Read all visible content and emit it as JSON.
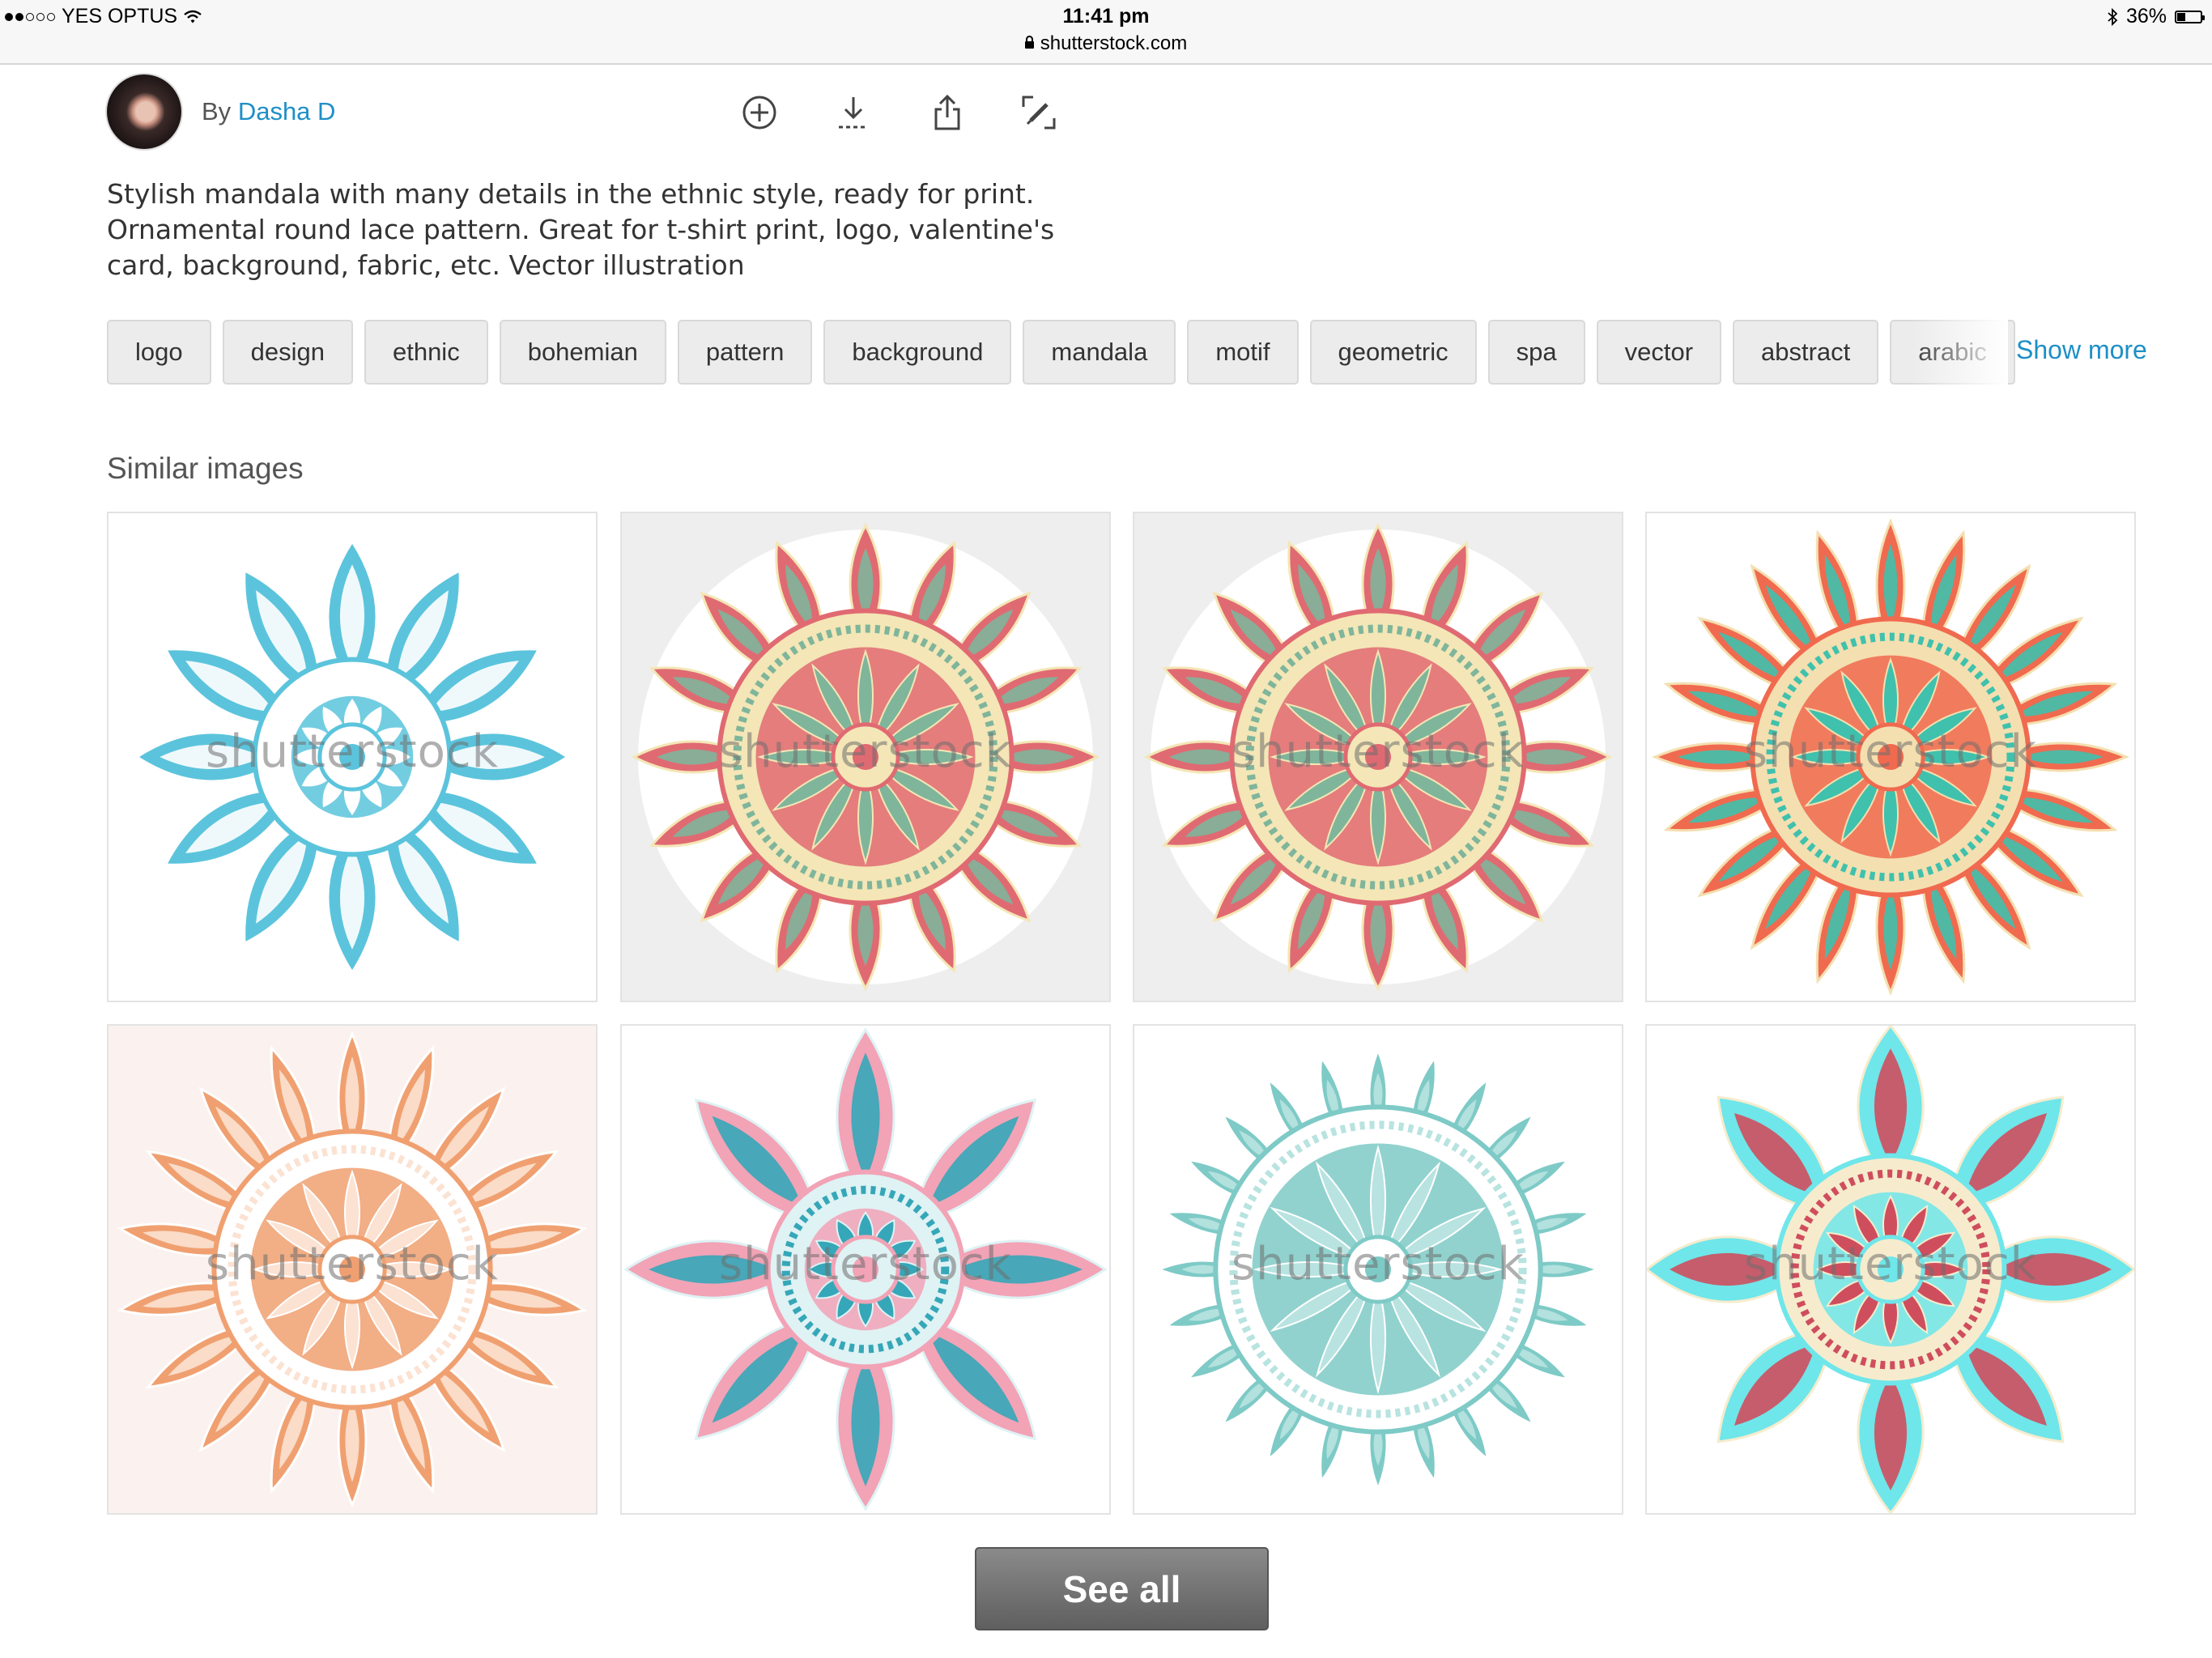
{
  "status_bar": {
    "carrier": "YES OPTUS",
    "time": "11:41 pm",
    "url": "shutterstock.com",
    "battery": "36%",
    "battery_level": 0.36,
    "signal_bars_filled": 2,
    "signal_bars_total": 5
  },
  "author": {
    "by_label": "By",
    "name": "Dasha D"
  },
  "actions": [
    {
      "icon": "add-circle-icon"
    },
    {
      "icon": "download-icon"
    },
    {
      "icon": "share-icon"
    },
    {
      "icon": "edit-icon"
    }
  ],
  "description": "Stylish mandala with many details in the ethnic style, ready for print. Ornamental round lace pattern. Great for t-shirt print, logo, valentine's card, background, fabric, etc. Vector illustration",
  "tags": [
    "logo",
    "design",
    "ethnic",
    "bohemian",
    "pattern",
    "background",
    "mandala",
    "motif",
    "geometric",
    "spa",
    "vector",
    "abstract",
    "arabic"
  ],
  "show_more_label": "Show more",
  "similar_title": "Similar images",
  "watermark_text": "shutterstock",
  "similar_images": [
    {
      "style": "blue-lace-mandala",
      "colors": [
        "#5bc4dc",
        "#ffffff"
      ]
    },
    {
      "style": "coral-sage-mandala",
      "colors": [
        "#e06a72",
        "#7fb59b",
        "#f4e6b6"
      ]
    },
    {
      "style": "coral-sage-mandala",
      "colors": [
        "#e06a72",
        "#7fb59b",
        "#f4e6b6"
      ]
    },
    {
      "style": "coral-teal-mandala",
      "colors": [
        "#f06a4f",
        "#3fc1ad",
        "#f4dfb0"
      ]
    },
    {
      "style": "peach-lace-mandala",
      "colors": [
        "#f0a070",
        "#fbe2d2",
        "#ffffff"
      ]
    },
    {
      "style": "pink-teal-mandala",
      "colors": [
        "#f2a3b6",
        "#35a7b8",
        "#dff2f4"
      ]
    },
    {
      "style": "mint-lace-mandala",
      "colors": [
        "#7ecac6",
        "#b8e3e0",
        "#ffffff"
      ]
    },
    {
      "style": "cyan-star-mandala",
      "colors": [
        "#6fe6ea",
        "#cf4e5e",
        "#f6eccd"
      ]
    }
  ],
  "see_all_label": "See all",
  "colors": {
    "link": "#1e8fc6",
    "tag_bg": "#ececec",
    "see_all_bg": "#6f6f6f"
  }
}
